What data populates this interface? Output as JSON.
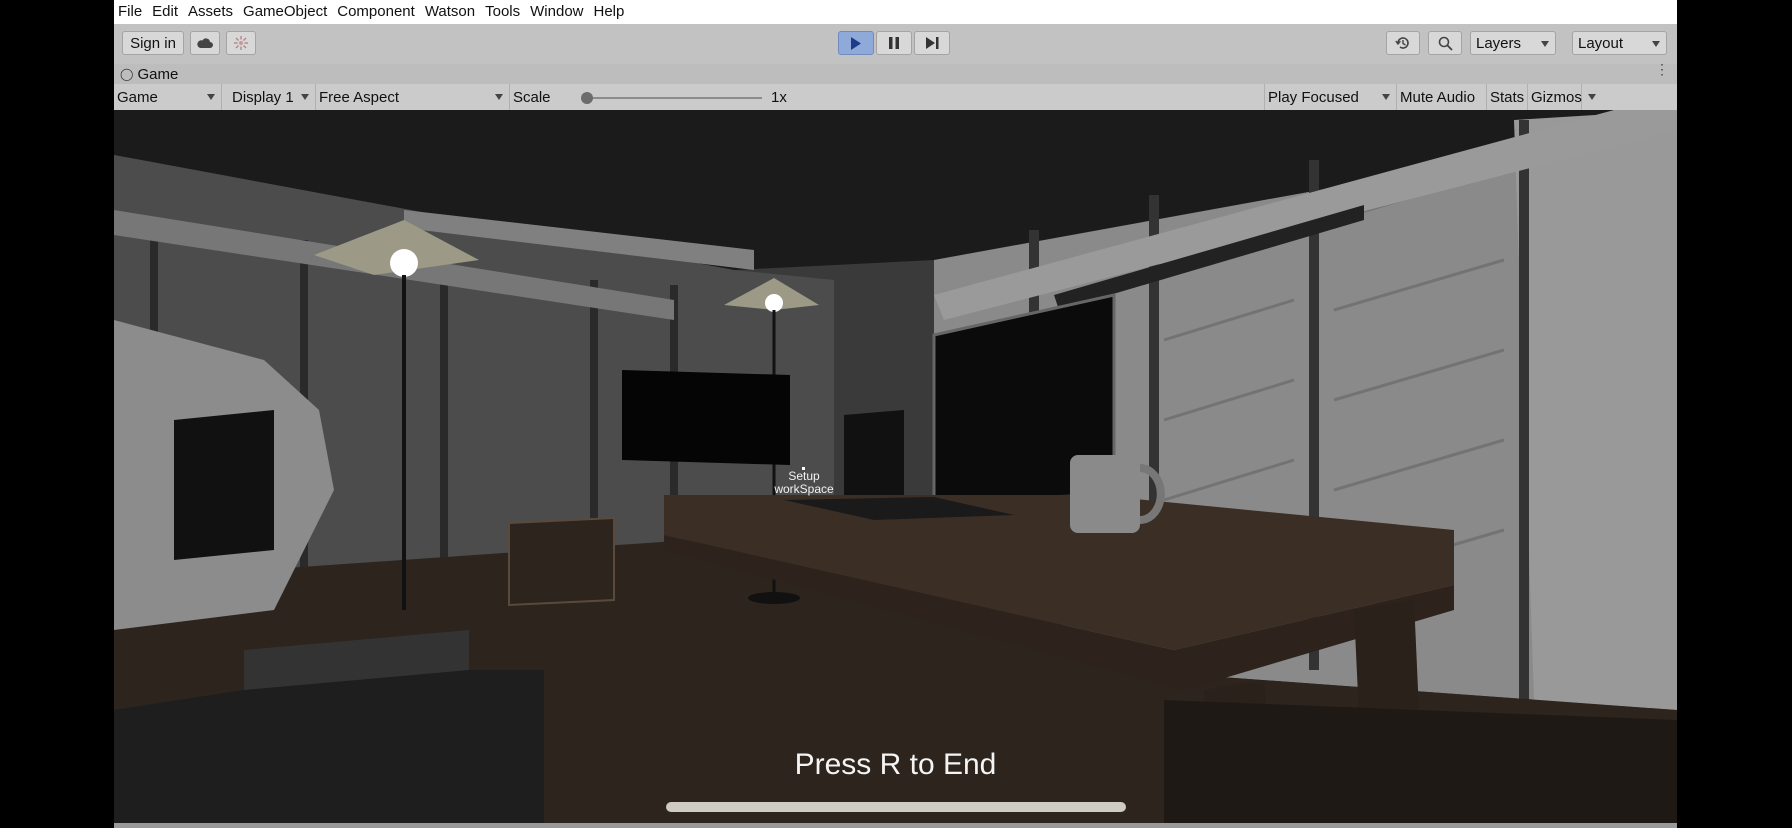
{
  "menu": [
    "File",
    "Edit",
    "Assets",
    "GameObject",
    "Component",
    "Watson",
    "Tools",
    "Window",
    "Help"
  ],
  "toolbar": {
    "sign_in_label": "Sign in",
    "layers_label": "Layers",
    "layout_label": "Layout"
  },
  "tab": {
    "title": "Game"
  },
  "game_bar": {
    "view_mode": "Game",
    "display": "Display 1",
    "aspect": "Free Aspect",
    "scale_label": "Scale",
    "scale_value": "1x",
    "play_mode": "Play Focused",
    "mute_audio": "Mute Audio",
    "stats": "Stats",
    "gizmos": "Gizmos"
  },
  "game_view": {
    "interaction_label_line1": "Setup",
    "interaction_label_line2": "workSpace",
    "prompt": "Press R to End"
  }
}
